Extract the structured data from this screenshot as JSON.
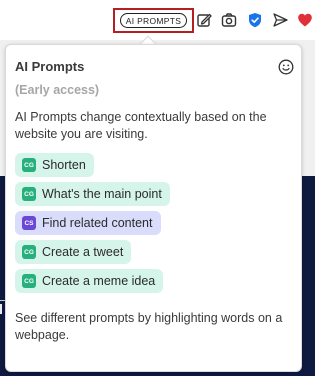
{
  "toolbar": {
    "ai_prompts_label": "AI PROMPTS",
    "icons": [
      "edit-icon",
      "camera-icon",
      "shield-check-icon",
      "send-icon",
      "heart-icon"
    ],
    "colors": {
      "highlight": "#b21f24",
      "shield": "#1a73e8",
      "heart": "#e0303a"
    }
  },
  "popup": {
    "title": "AI Prompts",
    "subtitle": "(Early access)",
    "description": "AI Prompts change contextually based on the website you are visiting.",
    "prompts": [
      {
        "badge": "CG",
        "label": "Shorten",
        "color": "#27b07d"
      },
      {
        "badge": "CG",
        "label": "What's the main point",
        "color": "#27b07d"
      },
      {
        "badge": "CS",
        "label": "Find related content",
        "color": "#6b47d6"
      },
      {
        "badge": "CG",
        "label": "Create a tweet",
        "color": "#27b07d"
      },
      {
        "badge": "CG",
        "label": "Create a meme idea",
        "color": "#27b07d"
      }
    ],
    "footer": "See different prompts by highlighting words on a webpage."
  }
}
